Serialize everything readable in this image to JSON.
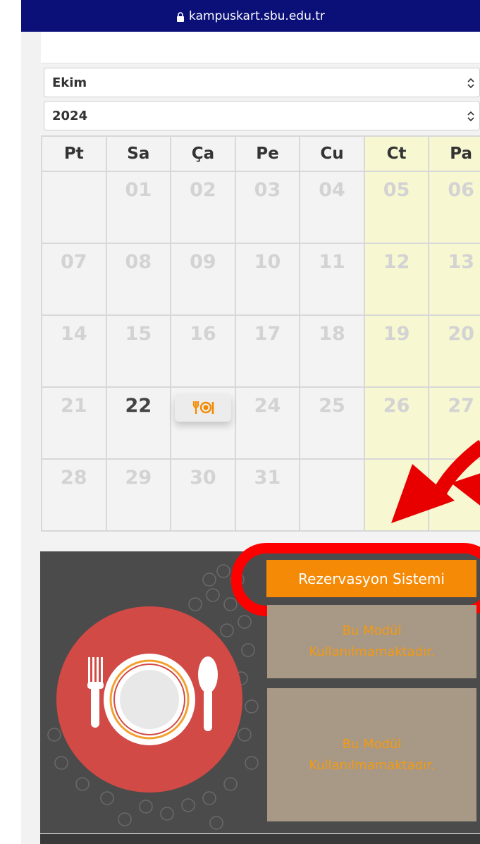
{
  "browser": {
    "url": "kampuskart.sbu.edu.tr"
  },
  "filters": {
    "month": "Ekim",
    "year": "2024"
  },
  "calendar": {
    "headers": [
      "Pt",
      "Sa",
      "Ça",
      "Pe",
      "Cu",
      "Ct",
      "Pa"
    ],
    "weeks": [
      [
        "",
        "01",
        "02",
        "03",
        "04",
        "05",
        "06"
      ],
      [
        "07",
        "08",
        "09",
        "10",
        "11",
        "12",
        "13"
      ],
      [
        "14",
        "15",
        "16",
        "17",
        "18",
        "19",
        "20"
      ],
      [
        "21",
        "22",
        "",
        "24",
        "25",
        "26",
        "27"
      ],
      [
        "28",
        "29",
        "30",
        "31",
        "",
        "",
        ""
      ]
    ],
    "today": "22",
    "meal_day": "23",
    "meal_icon": "utensils-plate-icon",
    "weekend_color": "#f7f7d2"
  },
  "modules": {
    "reservation_button": "Rezervasyon Sistemi",
    "unused_1": "Bu Modül Kullanılmamaktadır.",
    "unused_2": "Bu Modül Kullanılmamaktadır.",
    "accent_color": "#f58a07",
    "highlight_color": "#ff0000"
  }
}
